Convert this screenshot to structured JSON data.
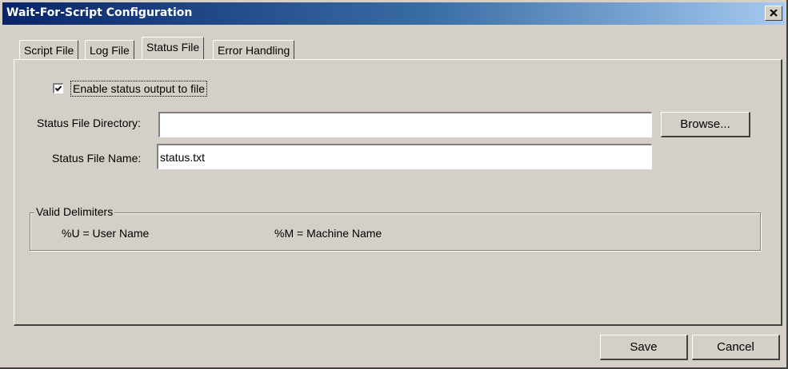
{
  "window": {
    "title": "Wait-For-Script Configuration"
  },
  "tabs": [
    {
      "label": "Script File",
      "active": false
    },
    {
      "label": "Log File",
      "active": false
    },
    {
      "label": "Status File",
      "active": true
    },
    {
      "label": "Error Handling",
      "active": false
    }
  ],
  "status_tab": {
    "enable_checkbox": {
      "label": "Enable status output to file",
      "checked": true
    },
    "directory": {
      "label": "Status File Directory:",
      "value": ""
    },
    "browse_label": "Browse...",
    "file_name": {
      "label": "Status File Name:",
      "value": "status.txt"
    },
    "delimiters": {
      "title": "Valid Delimiters",
      "user": "%U = User Name",
      "machine": "%M = Machine Name"
    }
  },
  "footer": {
    "save_label": "Save",
    "cancel_label": "Cancel"
  },
  "colors": {
    "face": "#d4d0c8",
    "title_start": "#0a246a",
    "title_end": "#a6caf0"
  },
  "icons": {
    "close": "close-icon",
    "check": "checkmark-icon"
  }
}
